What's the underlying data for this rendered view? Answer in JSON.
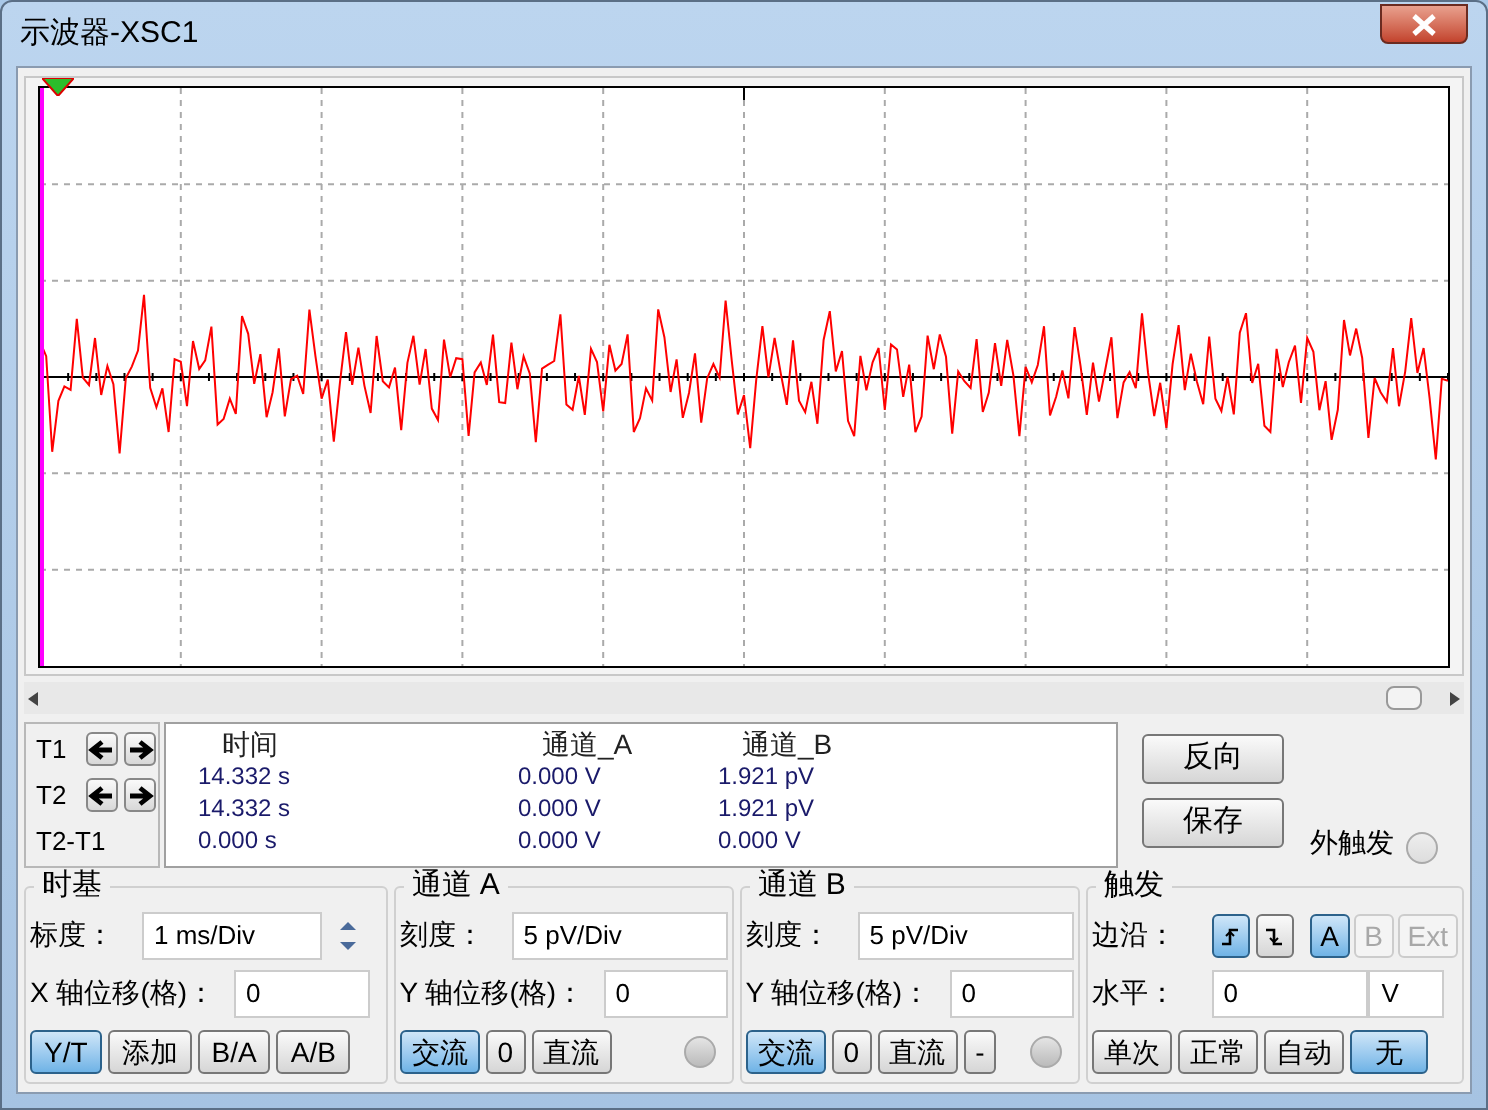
{
  "window": {
    "title": "示波器-XSC1"
  },
  "cursors": {
    "columns": [
      "时间",
      "通道_A",
      "通道_B"
    ],
    "rows": [
      {
        "label": "T1",
        "arrows": true,
        "values": [
          "14.332 s",
          "0.000 V",
          "1.921 pV"
        ]
      },
      {
        "label": "T2",
        "arrows": true,
        "values": [
          "14.332 s",
          "0.000 V",
          "1.921 pV"
        ]
      },
      {
        "label": "T2-T1",
        "arrows": false,
        "values": [
          "0.000 s",
          "0.000 V",
          "0.000 V"
        ]
      }
    ]
  },
  "actions": [
    "反向",
    "保存"
  ],
  "external_trigger": {
    "label": "外触发",
    "checked": false
  },
  "timebase": {
    "title": "时基",
    "scale_label": "标度：",
    "scale_value": "1 ms/Div",
    "offset_label": "X 轴位移(格)：",
    "offset_value": "0",
    "modes": [
      {
        "label": "Y/T",
        "selected": true
      },
      {
        "label": "添加",
        "selected": false
      },
      {
        "label": "B/A",
        "selected": false
      },
      {
        "label": "A/B",
        "selected": false
      }
    ]
  },
  "channels": [
    {
      "title": "通道 A",
      "scale_label": "刻度：",
      "scale_value": "5 pV/Div",
      "offset_label": "Y 轴位移(格)：",
      "offset_value": "0",
      "coupling": [
        {
          "label": "交流",
          "selected": true
        },
        {
          "label": "0",
          "selected": false
        },
        {
          "label": "直流",
          "selected": false
        }
      ],
      "checked": false
    },
    {
      "title": "通道 B",
      "scale_label": "刻度：",
      "scale_value": "5 pV/Div",
      "offset_label": "Y 轴位移(格)：",
      "offset_value": "0",
      "coupling": [
        {
          "label": "交流",
          "selected": true
        },
        {
          "label": "0",
          "selected": false
        },
        {
          "label": "直流",
          "selected": false
        },
        {
          "label": "-",
          "selected": false
        }
      ],
      "checked": false
    }
  ],
  "trigger": {
    "title": "触发",
    "edge_label": "边沿：",
    "edges": [
      {
        "kind": "rising",
        "selected": true
      },
      {
        "kind": "falling",
        "selected": false
      }
    ],
    "sources": [
      {
        "label": "A",
        "selected": true,
        "disabled": false
      },
      {
        "label": "B",
        "selected": false,
        "disabled": true
      },
      {
        "label": "Ext",
        "selected": false,
        "disabled": true
      }
    ],
    "level_label": "水平：",
    "level_value": "0",
    "level_unit": "V",
    "modes": [
      {
        "label": "单次",
        "selected": false
      },
      {
        "label": "正常",
        "selected": false
      },
      {
        "label": "自动",
        "selected": false
      },
      {
        "label": "无",
        "selected": true
      }
    ]
  }
}
